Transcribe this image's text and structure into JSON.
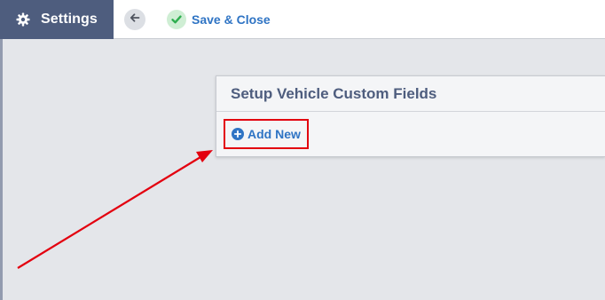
{
  "header": {
    "settings_label": "Settings",
    "save_close_label": "Save & Close"
  },
  "panel": {
    "title": "Setup Vehicle Custom Fields",
    "add_new_label": "Add New"
  },
  "colors": {
    "header_bg": "#4e5d7e",
    "link_blue": "#2f74c4",
    "success_green": "#2eae4f",
    "annotation_red": "#e3000f",
    "page_bg": "#e4e6ea"
  },
  "icons": [
    "gear-icon",
    "back-arrow-icon",
    "checkmark-icon",
    "plus-circle-icon"
  ]
}
